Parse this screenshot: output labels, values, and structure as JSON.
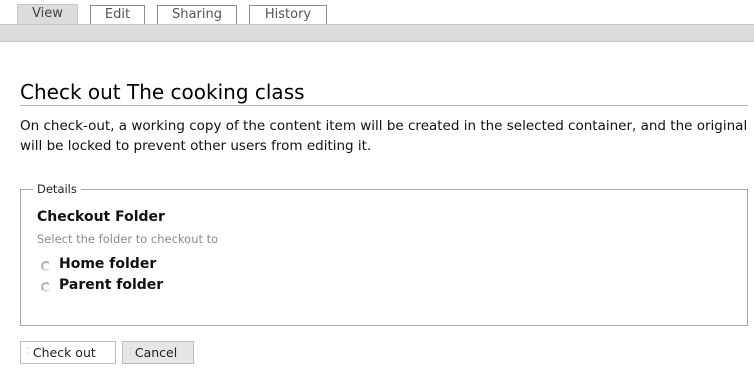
{
  "tabs": [
    {
      "label": "View",
      "active": true
    },
    {
      "label": "Edit",
      "active": false
    },
    {
      "label": "Sharing",
      "active": false
    },
    {
      "label": "History",
      "active": false
    }
  ],
  "page": {
    "title": "Check out The cooking class",
    "description": "On check-out, a working copy of the content item will be created in the selected container, and the original will be locked to prevent other users from editing it."
  },
  "details": {
    "legend": "Details",
    "field_label": "Checkout Folder",
    "field_help": "Select the folder to checkout to",
    "options": [
      {
        "label": "Home folder",
        "selected": false
      },
      {
        "label": "Parent folder",
        "selected": false
      }
    ]
  },
  "actions": {
    "checkout_label": "Check out",
    "cancel_label": "Cancel"
  },
  "icons": {
    "radio": "radio-icon",
    "grip": "grip-icon"
  },
  "colors": {
    "band": "#dcdcdc",
    "border": "#a8a8a8",
    "help_text": "#8a8a8a"
  }
}
